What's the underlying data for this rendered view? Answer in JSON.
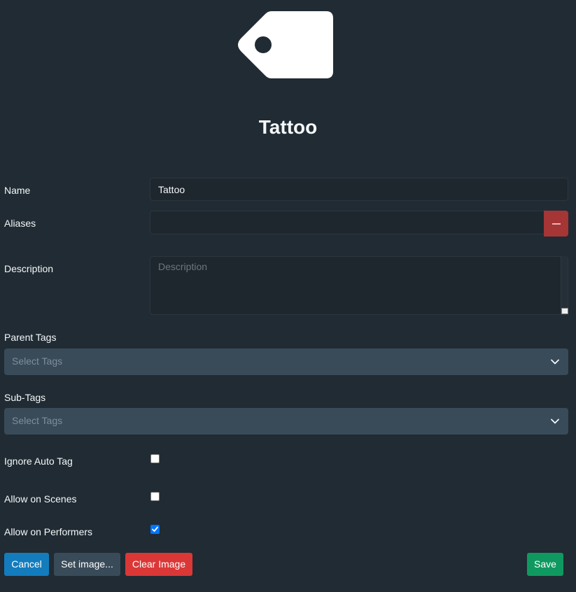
{
  "header": {
    "title": "Tattoo",
    "image_icon": "tag-icon"
  },
  "form": {
    "name": {
      "label": "Name",
      "value": "Tattoo"
    },
    "aliases": {
      "label": "Aliases",
      "value": "",
      "remove_icon": "minus-icon"
    },
    "description": {
      "label": "Description",
      "value": "",
      "placeholder": "Description"
    },
    "parent_tags": {
      "label": "Parent Tags",
      "placeholder": "Select Tags",
      "icon": "chevron-down-icon"
    },
    "sub_tags": {
      "label": "Sub-Tags",
      "placeholder": "Select Tags",
      "icon": "chevron-down-icon"
    },
    "ignore_auto_tag": {
      "label": "Ignore Auto Tag",
      "checked": false
    },
    "allow_on_scenes": {
      "label": "Allow on Scenes",
      "checked": false
    },
    "allow_on_performers": {
      "label": "Allow on Performers",
      "checked": true
    }
  },
  "actions": {
    "cancel_label": "Cancel",
    "set_image_label": "Set image...",
    "clear_image_label": "Clear Image",
    "save_label": "Save"
  },
  "colors": {
    "background": "#202b33",
    "input_background": "#1f272e",
    "select_background": "#394b59",
    "primary": "#137cbd",
    "danger": "#db3737",
    "success": "#0f9960",
    "remove_button": "#a63535"
  }
}
